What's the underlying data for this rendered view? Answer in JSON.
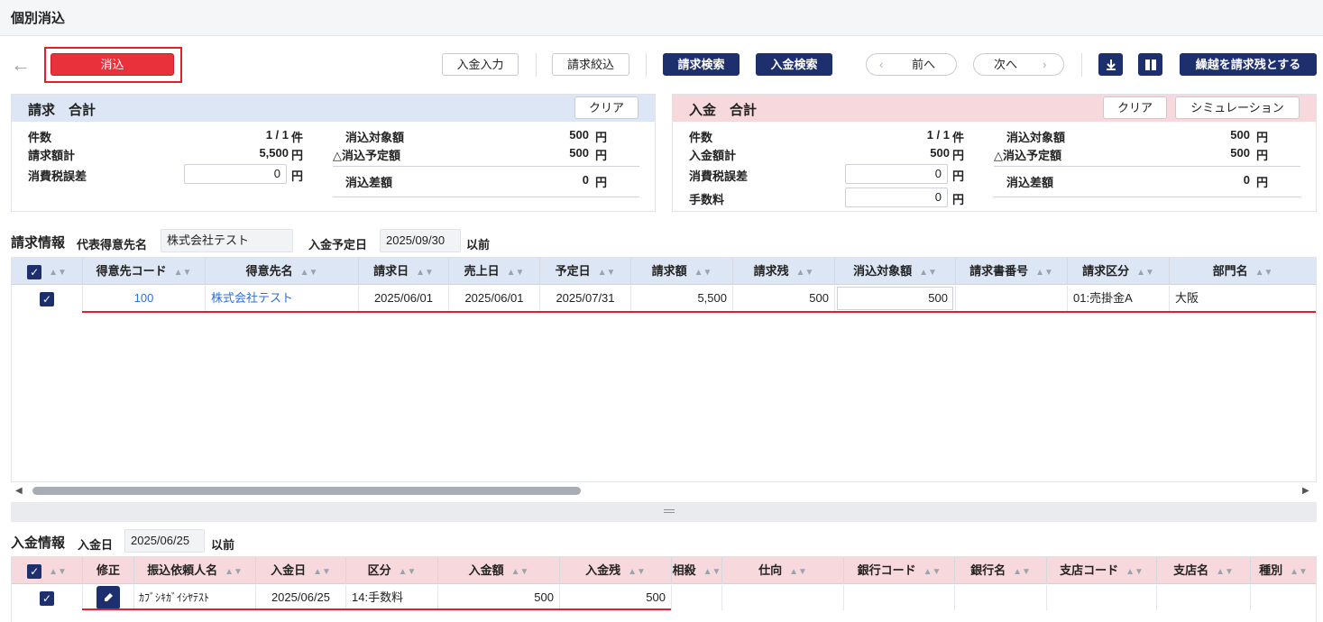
{
  "page": {
    "title": "個別消込"
  },
  "toolbar": {
    "apply": "消込",
    "payment_input": "入金入力",
    "invoice_filter": "請求絞込",
    "invoice_search": "請求検索",
    "payment_search": "入金検索",
    "prev": "前へ",
    "next": "次へ",
    "carryover": "繰越を請求残とする"
  },
  "invoice_summary": {
    "title": "請求　合計",
    "clear": "クリア",
    "count_label": "件数",
    "count_value": "1 / 1",
    "count_unit": "件",
    "total_label": "請求額計",
    "total_value": "5,500",
    "total_unit": "円",
    "tax_label": "消費税誤差",
    "tax_value": "0",
    "tax_unit": "円",
    "target_label": "消込対象額",
    "target_value": "500",
    "target_unit": "円",
    "planned_label": "△消込予定額",
    "planned_value": "500",
    "planned_unit": "円",
    "diff_label": "消込差額",
    "diff_value": "0",
    "diff_unit": "円"
  },
  "payment_summary": {
    "title": "入金　合計",
    "clear": "クリア",
    "simulation": "シミュレーション",
    "count_label": "件数",
    "count_value": "1 / 1",
    "count_unit": "件",
    "total_label": "入金額計",
    "total_value": "500",
    "total_unit": "円",
    "tax_label": "消費税誤差",
    "tax_value": "0",
    "tax_unit": "円",
    "fee_label": "手数料",
    "fee_value": "0",
    "fee_unit": "円",
    "target_label": "消込対象額",
    "target_value": "500",
    "target_unit": "円",
    "planned_label": "△消込予定額",
    "planned_value": "500",
    "planned_unit": "円",
    "diff_label": "消込差額",
    "diff_value": "0",
    "diff_unit": "円"
  },
  "invoice_info": {
    "title": "請求情報",
    "customer_label": "代表得意先名",
    "customer_value": "株式会社テスト",
    "due_label": "入金予定日",
    "due_value": "2025/09/30",
    "due_suffix": "以前",
    "columns": [
      "得意先コード",
      "得意先名",
      "請求日",
      "売上日",
      "予定日",
      "請求額",
      "請求残",
      "消込対象額",
      "請求書番号",
      "請求区分",
      "部門名"
    ],
    "row": {
      "code": "100",
      "name": "株式会社テスト",
      "invoice_date": "2025/06/01",
      "sales_date": "2025/06/01",
      "due_date": "2025/07/31",
      "amount": "5,500",
      "remaining": "500",
      "target": "500",
      "number": "",
      "category": "01:売掛金A",
      "dept": "大阪"
    }
  },
  "payment_info": {
    "title": "入金情報",
    "date_label": "入金日",
    "date_value": "2025/06/25",
    "date_suffix": "以前",
    "columns": [
      "修正",
      "振込依頼人名",
      "入金日",
      "区分",
      "入金額",
      "入金残",
      "相殺",
      "仕向",
      "銀行コード",
      "銀行名",
      "支店コード",
      "支店名",
      "種別"
    ],
    "row": {
      "requester": "ｶﾌﾞｼｷｶﾞｲｼﾔﾃｽﾄ",
      "date": "2025/06/25",
      "category": "14:手数料",
      "amount": "500",
      "remaining": "500"
    }
  },
  "colors": {
    "accent_red": "#e8313a",
    "navy": "#1e2f6e",
    "invoice_head": "#dce6f5",
    "payment_head": "#f7d9dd"
  }
}
